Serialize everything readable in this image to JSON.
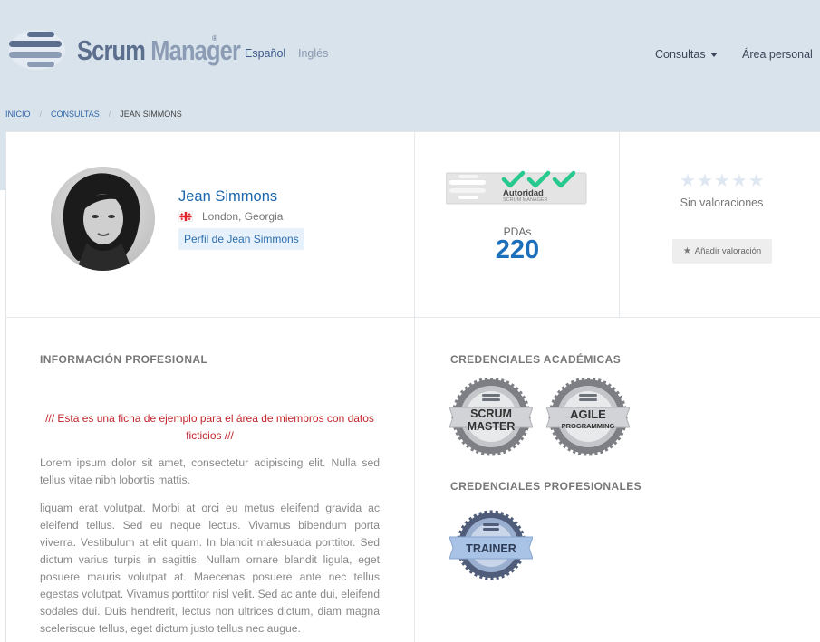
{
  "header": {
    "logo": {
      "word1": "Scrum",
      "word2": "Manager",
      "reg": "®"
    },
    "languages": {
      "spanish": "Español",
      "english": "Inglés"
    },
    "nav": {
      "consultas": "Consultas",
      "area_personal": "Área personal"
    }
  },
  "breadcrumb": {
    "home": "INICIO",
    "section": "CONSULTAS",
    "current": "JEAN SIMMONS"
  },
  "profile": {
    "name": "Jean Simmons",
    "location": "London, Georgia",
    "profile_link": "Perfil de Jean Simmons"
  },
  "authority": {
    "badge_title": "Autoridad",
    "badge_sub": "SCRUM MANAGER",
    "pdas_label": "PDAs",
    "pdas_value": "220"
  },
  "rating": {
    "stars_filled": 0,
    "stars_total": 5,
    "status": "Sin valoraciones",
    "add_button": "Añadir valoración"
  },
  "professional_info": {
    "title": "INFORMACIÓN PROFESIONAL",
    "demo_note": "/// Esta es una ficha de ejemplo para el área de miembros con datos ficticios ///",
    "paragraph1": "Lorem ipsum dolor sit amet, consectetur adipiscing elit. Nulla sed tellus vitae nibh lobortis mattis.",
    "paragraph2": "liquam erat volutpat. Morbi at orci eu metus eleifend gravida ac eleifend tellus. Sed eu neque lectus. Vivamus bibendum porta viverra. Vestibulum at elit quam. In blandit malesuada porttitor. Sed dictum varius turpis in sagittis. Nullam ornare blandit ligula, eget posuere mauris volutpat at. Maecenas posuere ante nec tellus egestas volutpat. Vivamus porttitor nisl velit. Sed ac ante dui, eleifend sodales dui. Duis hendrerit, lectus non ultrices dictum, diam magna scelerisque tellus, eget dictum justo tellus nec augue."
  },
  "academic_credentials": {
    "title": "CREDENCIALES ACADÉMICAS",
    "badges": [
      {
        "line1": "SCRUM",
        "line2": "MASTER"
      },
      {
        "line1": "AGILE",
        "line2": "PROGRAMMING"
      }
    ]
  },
  "professional_credentials": {
    "title": "CREDENCIALES PROFESIONALES",
    "badges": [
      {
        "line1": "TRAINER"
      }
    ]
  },
  "colors": {
    "header_bg": "#d9e3ec",
    "link_blue": "#1d66ad",
    "demo_red": "#c0262d",
    "check_green": "#27c98e"
  }
}
